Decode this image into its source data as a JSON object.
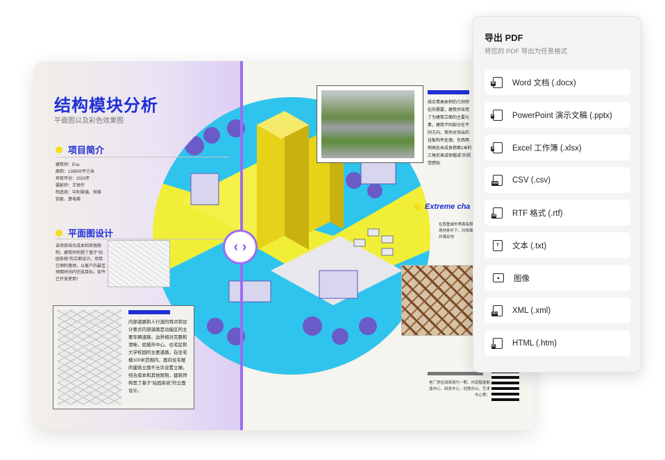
{
  "document": {
    "title": "结构模块分析",
    "subtitle": "平面图以及彩色效果图",
    "project_heading": "项目简介",
    "project_info": [
      "建筑师：Eva",
      "面积：138500平方米",
      "项目年份：2023年",
      "摄影师：王钟许",
      "制造商：中利玻璃、恒美",
      "铝板、算电梯"
    ],
    "plan_heading": "平面图设计",
    "plan_text": "该项目结合成本和其他限制，建筑师构想了基于\"拈园系统\"的立面设计。项目已顺利落地，以客户的最佳预期时间内完成目标，如今已开发使用！",
    "sketch_text": "内部道路和人行道的特点和设计要点内部道路是功能区的主要车辆道路，边界相对完整和清晰，如城市中心、住宅区和大学校园的主要道路，在住宅楼100米范围内，面向住宅楼的建筑立面不允许设置立噪。结合成本和其他限制，建筑师构思了基于\"拈园系统\"的立面设计。",
    "photo_text": "结合青曲体积的几何特征的需要，建筑师采用了为建筑立面的主要元素。建筑不同部分在不同方向，筑师对突出的挂板构件处理。东西两侧高处米成食俯面1米的三角形表成铜俄成\"的视觉感知",
    "extreme_heading": "Extreme cha",
    "extreme_text": "在尊重城市界面有限的场地条件下，问体面，并满足地",
    "bottom_text": "老厂房拉阔商场为一期，内设智能制造中心、研发中心、创意办公、艺术中心等；"
  },
  "compare_handle": "‹ ›",
  "colors": {
    "accent": "#1e2fd6",
    "purple": "#9c6df2",
    "yellow": "#f3df1a"
  },
  "export_panel": {
    "title": "导出 PDF",
    "subtitle": "将您的 PDF 导出为任意格式",
    "options": [
      {
        "label": "Word 文档 (.docx)",
        "icon": "word-icon"
      },
      {
        "label": "PowerPoint 演示文稿 (.pptx)",
        "icon": "powerpoint-icon"
      },
      {
        "label": "Excel 工作簿 (.xlsx)",
        "icon": "excel-icon"
      },
      {
        "label": "CSV (.csv)",
        "icon": "csv-icon"
      },
      {
        "label": "RTF 格式 (.rtf)",
        "icon": "rtf-icon"
      },
      {
        "label": "文本 (.txt)",
        "icon": "text-icon"
      },
      {
        "label": "图像",
        "icon": "image-icon"
      },
      {
        "label": "XML (.xml)",
        "icon": "xml-icon"
      },
      {
        "label": "HTML (.htm)",
        "icon": "html-icon"
      }
    ]
  }
}
